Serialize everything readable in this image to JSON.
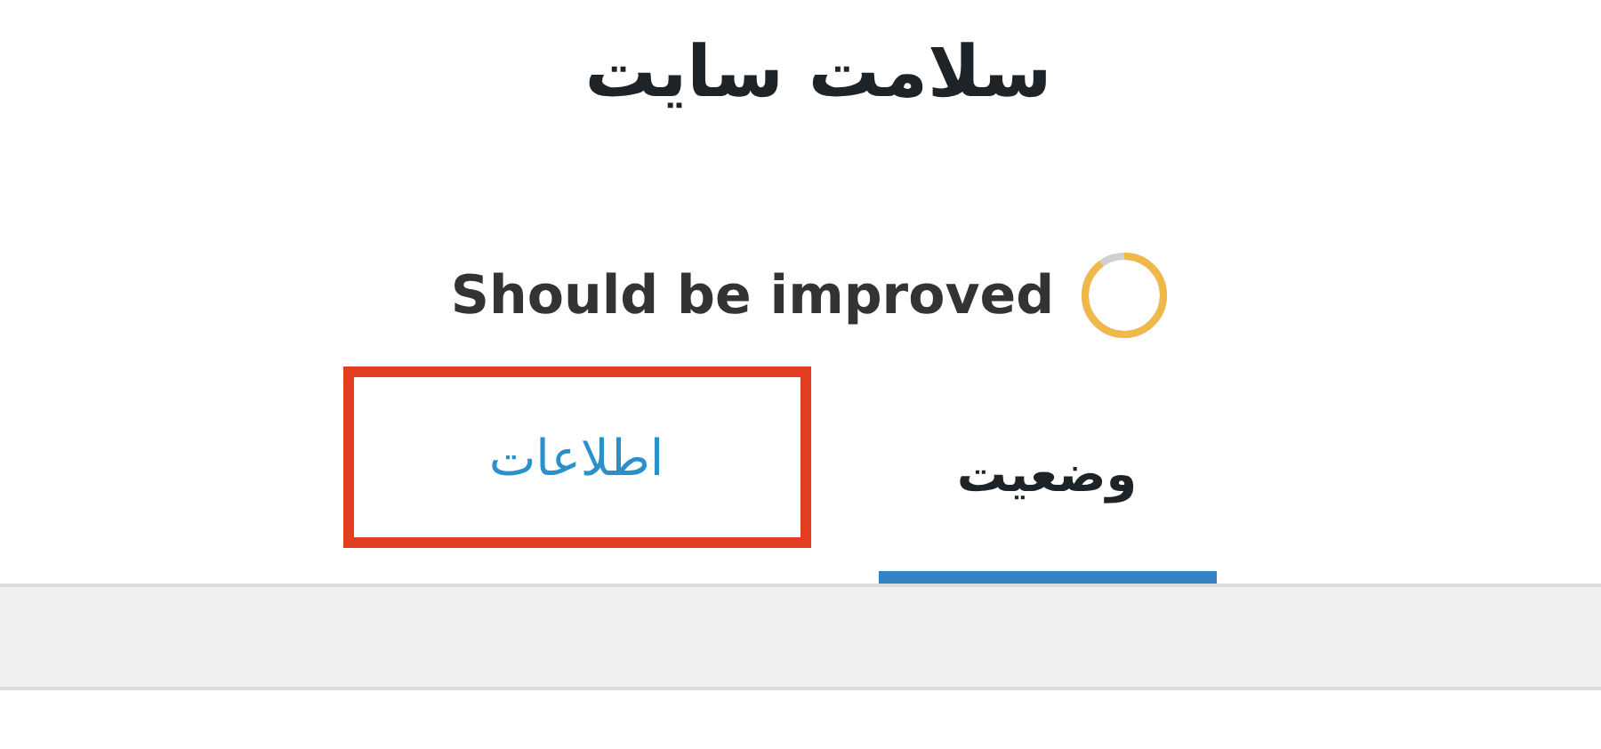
{
  "title": "سلامت سایت",
  "status": {
    "label": "Should be improved"
  },
  "tabs": [
    {
      "label": "وضعیت",
      "selected": true,
      "highlighted": false
    },
    {
      "label": "اطلاعات",
      "selected": false,
      "highlighted": true
    }
  ]
}
